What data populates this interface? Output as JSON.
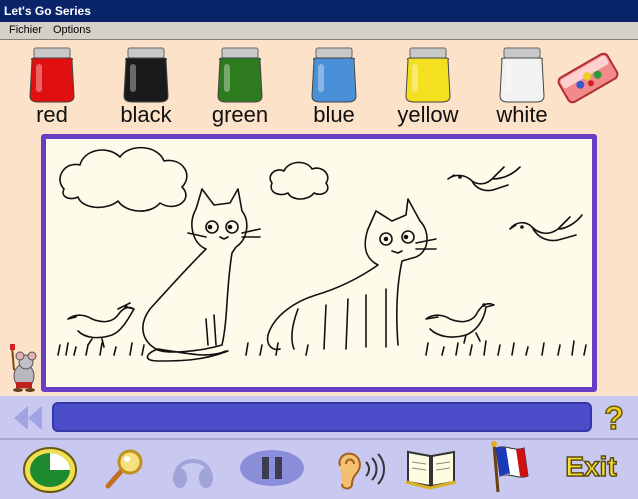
{
  "window": {
    "title": "Let's Go Series"
  },
  "menu": {
    "items": [
      "Fichier",
      "Options"
    ]
  },
  "palette": [
    {
      "label": "red",
      "color": "#e01010"
    },
    {
      "label": "black",
      "color": "#1a1a1a"
    },
    {
      "label": "green",
      "color": "#2e7a1e"
    },
    {
      "label": "blue",
      "color": "#4a90d8"
    },
    {
      "label": "yellow",
      "color": "#f4e020"
    },
    {
      "label": "white",
      "color": "#f2f2f2"
    }
  ],
  "tools": {
    "eraser": "eraser-icon",
    "mascot": "mouse-painter-icon"
  },
  "drawing": {
    "subjects": [
      "cat",
      "cat",
      "bird",
      "bird",
      "bird",
      "bird",
      "cloud",
      "cloud"
    ]
  },
  "controls": {
    "back": "rewind-icon",
    "help_label": "?",
    "clock": "clock-icon",
    "magnifier": "magnifier-icon",
    "headphones": "headphones-icon",
    "pause": "pause-icon",
    "ear": "ear-listen-icon",
    "book": "book-icon",
    "flag": "french-flag-icon",
    "exit_label": "Exit"
  }
}
